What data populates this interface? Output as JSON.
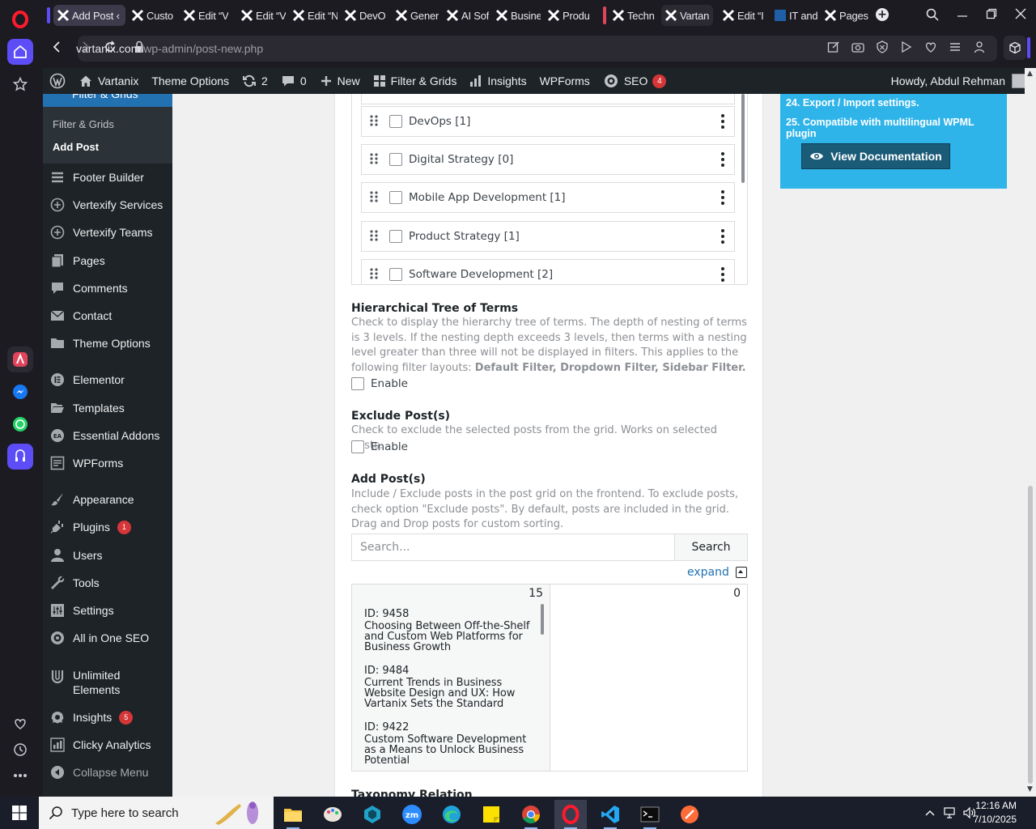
{
  "browser": {
    "tabs": [
      {
        "label": "Add Post ‹",
        "active": true
      },
      {
        "label": "Custo"
      },
      {
        "label": "Edit “V"
      },
      {
        "label": "Edit “V"
      },
      {
        "label": "Edit “N"
      },
      {
        "label": "DevO"
      },
      {
        "label": "Gener"
      },
      {
        "label": "AI Sof"
      },
      {
        "label": "Busine"
      },
      {
        "label": "Produ"
      },
      {
        "label": "Techn"
      },
      {
        "label": "Vartan"
      },
      {
        "label": "Edit “I"
      },
      {
        "label": "IT and"
      },
      {
        "label": "Pages"
      }
    ],
    "url_host": "vartanix.com",
    "url_path": "/wp-admin/post-new.php"
  },
  "admin_bar": {
    "site_name": "Vartanix",
    "theme_options": "Theme Options",
    "updates_count": "2",
    "comments_count": "0",
    "new_label": "New",
    "filter_grids": "Filter & Grids",
    "insights": "Insights",
    "wpforms": "WPForms",
    "seo": "SEO",
    "seo_badge": "4",
    "howdy": "Howdy, Abdul Rehman"
  },
  "sidebar": {
    "current_top": "Filter & Grids",
    "submenu": [
      "Filter & Grids",
      "Add Post"
    ],
    "items": [
      {
        "label": "Footer Builder",
        "icon": "footer-icon"
      },
      {
        "label": "Vertexify Services",
        "icon": "plus-circle-icon"
      },
      {
        "label": "Vertexify Teams",
        "icon": "plus-circle-icon"
      },
      {
        "label": "Pages",
        "icon": "pages-icon"
      },
      {
        "label": "Comments",
        "icon": "comment-icon"
      },
      {
        "label": "Contact",
        "icon": "mail-icon"
      },
      {
        "label": "Theme Options",
        "icon": "folder-icon"
      },
      {
        "label": "Elementor",
        "icon": "elementor-icon"
      },
      {
        "label": "Templates",
        "icon": "folder-open-icon"
      },
      {
        "label": "Essential Addons",
        "icon": "ea-icon"
      },
      {
        "label": "WPForms",
        "icon": "wpforms-icon"
      },
      {
        "label": "Appearance",
        "icon": "brush-icon"
      },
      {
        "label": "Plugins",
        "icon": "plugin-icon",
        "badge": "1"
      },
      {
        "label": "Users",
        "icon": "user-icon"
      },
      {
        "label": "Tools",
        "icon": "wrench-icon"
      },
      {
        "label": "Settings",
        "icon": "settings-icon"
      },
      {
        "label": "All in One SEO",
        "icon": "seo-icon"
      },
      {
        "label": "Unlimited Elements",
        "icon": "ue-icon"
      },
      {
        "label": "Insights",
        "icon": "insights-icon",
        "badge": "5"
      },
      {
        "label": "Clicky Analytics",
        "icon": "analytics-icon"
      },
      {
        "label": "Collapse Menu",
        "icon": "collapse-icon"
      }
    ]
  },
  "terms": [
    "DevOps [1]",
    "Digital Strategy [0]",
    "Mobile App Development [1]",
    "Product Strategy [1]",
    "Software Development [2]"
  ],
  "hierarchical": {
    "title": "Hierarchical Tree of Terms",
    "desc": "Check to display the hierarchy tree of terms. The depth of nesting of terms is 3 levels. If the nesting depth exceeds 3 levels, then terms with a nesting level greater than three will not be displayed in filters. This applies to the following filter layouts: ",
    "desc_bold": "Default Filter, Dropdown Filter, Sidebar Filter.",
    "enable": "Enable"
  },
  "exclude": {
    "title": "Exclude Post(s)",
    "desc": "Check to exclude the selected posts from the grid. Works on selected posts.",
    "enable": "Enable"
  },
  "add_posts": {
    "title": "Add Post(s)",
    "desc": "Include / Exclude posts in the post grid on the frontend. To exclude posts, check option \"Exclude posts\". By default, posts are included in the grid. Drag and Drop posts for custom sorting.",
    "search_placeholder": "Search...",
    "search_button": "Search",
    "expand": "expand",
    "pool_count": "15",
    "selected_count": "0",
    "posts": [
      {
        "id": "ID: 9458",
        "title": "Choosing Between Off-the-Shelf and Custom Web Platforms for Business Growth"
      },
      {
        "id": "ID: 9484",
        "title": "Current Trends in Business Website Design and UX: How Vartanix Sets the Standard"
      },
      {
        "id": "ID: 9422",
        "title": "Custom Software Development as a Means to Unlock Business Potential"
      }
    ]
  },
  "taxonomy_relation": "Taxonomy Relation",
  "doc_panel": {
    "line1": "24. Export / Import settings.",
    "line2": "25. Compatible with multilingual WPML plugin",
    "button": "View Documentation"
  },
  "taskbar": {
    "search_placeholder": "Type here to search",
    "time": "12:16 AM",
    "date": "7/10/2025"
  },
  "colors": {
    "wp_dark": "#1d2327",
    "wp_blue": "#2271b1",
    "doc_panel": "#2fb4e9",
    "badge_red": "#d63638"
  }
}
